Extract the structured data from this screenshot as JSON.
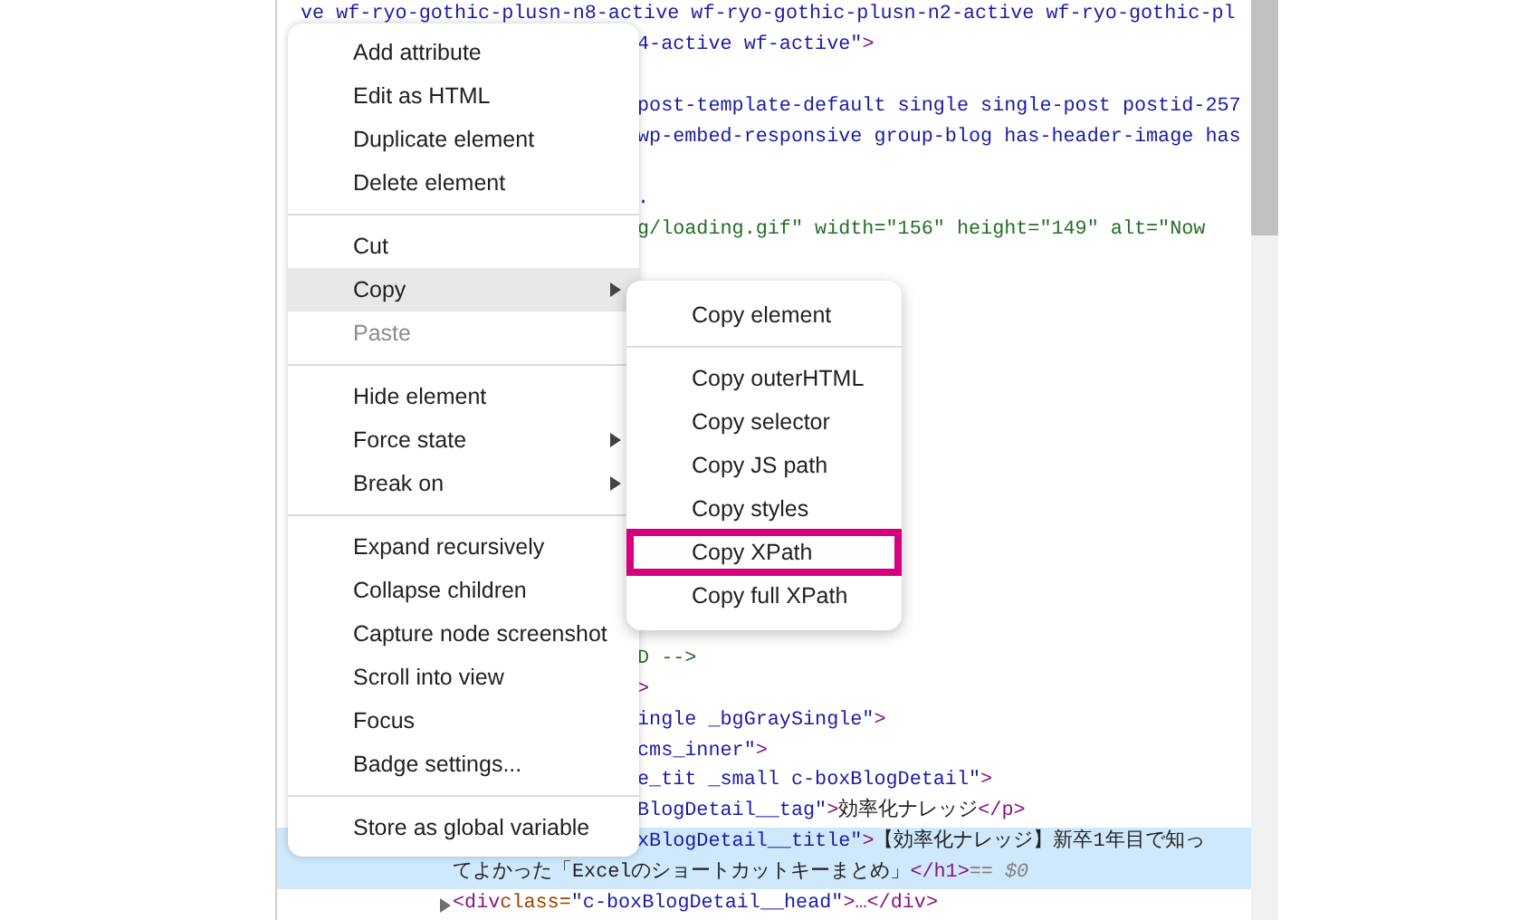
{
  "elements_panel": {
    "lines": [
      {
        "kind": "full",
        "selected": false,
        "segments": [
          {
            "kind": "value",
            "text": "ve wf-ryo-gothic-plusn-n8-active wf-ryo-gothic-plusn-n2-active wf-ryo-gothic-pl"
          }
        ]
      },
      {
        "kind": "clipped",
        "selected": false,
        "segments": [
          {
            "kind": "value",
            "text": "4-active wf-active\""
          },
          {
            "kind": "tag",
            "text": ">"
          }
        ]
      },
      {
        "kind": "covered",
        "selected": false
      },
      {
        "kind": "clipped",
        "selected": false,
        "segments": [
          {
            "kind": "value",
            "text": "post-template-default single single-post postid-257"
          }
        ]
      },
      {
        "kind": "clipped",
        "selected": false,
        "segments": [
          {
            "kind": "value",
            "text": "wp-embed-responsive group-blog has-header-image has"
          }
        ]
      },
      {
        "kind": "covered",
        "selected": false
      },
      {
        "kind": "clipped",
        "selected": false,
        "segments": [
          {
            "kind": "value",
            "text": "."
          }
        ]
      },
      {
        "kind": "clipped",
        "selected": false,
        "segments": [
          {
            "kind": "link",
            "text": "g/loading.gif\" width=\"156\" height=\"149\" alt=\"Now"
          }
        ]
      },
      {
        "kind": "covered",
        "selected": false
      },
      {
        "kind": "covered",
        "selected": false
      },
      {
        "kind": "covered",
        "selected": false
      },
      {
        "kind": "covered",
        "selected": false
      },
      {
        "kind": "covered",
        "selected": false
      },
      {
        "kind": "covered",
        "selected": false
      },
      {
        "kind": "covered",
        "selected": false
      },
      {
        "kind": "covered",
        "selected": false
      },
      {
        "kind": "covered",
        "selected": false
      },
      {
        "kind": "covered",
        "selected": false
      },
      {
        "kind": "covered",
        "selected": false
      },
      {
        "kind": "covered",
        "selected": false
      },
      {
        "kind": "covered",
        "selected": false
      },
      {
        "kind": "clipped",
        "selected": false,
        "segments": [
          {
            "kind": "comment",
            "text": "D -->"
          }
        ]
      },
      {
        "kind": "clipped",
        "selected": false,
        "segments": [
          {
            "kind": "tag",
            "text": ">"
          }
        ]
      },
      {
        "kind": "clipped",
        "selected": false,
        "segments": [
          {
            "kind": "value",
            "text": "ingle _bgGraySingle\""
          },
          {
            "kind": "tag",
            "text": ">"
          }
        ]
      },
      {
        "kind": "clipped",
        "selected": false,
        "segments": [
          {
            "kind": "value",
            "text": " cms_inner\""
          },
          {
            "kind": "tag",
            "text": ">"
          }
        ]
      },
      {
        "kind": "clipped",
        "selected": false,
        "segments": [
          {
            "kind": "value",
            "text": "e_tit _small c-boxBlogDetail\""
          },
          {
            "kind": "tag",
            "text": ">"
          }
        ]
      },
      {
        "kind": "clipped",
        "selected": false,
        "segments": [
          {
            "kind": "value",
            "text": "BlogDetail__tag\""
          },
          {
            "kind": "tag",
            "text": ">"
          },
          {
            "kind": "text",
            "text": "効率化ナレッジ"
          },
          {
            "kind": "tag",
            "text": "</p>"
          }
        ]
      },
      {
        "kind": "clipped",
        "selected": true,
        "segments": [
          {
            "kind": "value",
            "text": "xBlogDetail__title\""
          },
          {
            "kind": "tag",
            "text": ">"
          },
          {
            "kind": "text",
            "text": "【効率化ナレッジ】新卒1年目で知っ"
          }
        ]
      },
      {
        "kind": "wrap",
        "selected": true,
        "segments": [
          {
            "kind": "text",
            "text": "てよかった「Excelのショートカットキーまとめ」"
          },
          {
            "kind": "tag",
            "text": "</h1>"
          },
          {
            "kind": "hint",
            "text": " == $0"
          }
        ]
      },
      {
        "kind": "child",
        "selected": false,
        "segments": [
          {
            "kind": "tag",
            "text": "<div"
          },
          {
            "kind": "attr",
            "text": " class="
          },
          {
            "kind": "value",
            "text": "\"c-boxBlogDetail__head\""
          },
          {
            "kind": "tag",
            "text": ">…</div>"
          }
        ]
      }
    ]
  },
  "context_menu": {
    "groups": [
      {
        "items": [
          {
            "label": "Add attribute",
            "selected": false,
            "disabled": false,
            "has_submenu": false
          },
          {
            "label": "Edit as HTML",
            "selected": false,
            "disabled": false,
            "has_submenu": false
          },
          {
            "label": "Duplicate element",
            "selected": false,
            "disabled": false,
            "has_submenu": false
          },
          {
            "label": "Delete element",
            "selected": false,
            "disabled": false,
            "has_submenu": false
          }
        ]
      },
      {
        "items": [
          {
            "label": "Cut",
            "selected": false,
            "disabled": false,
            "has_submenu": false
          },
          {
            "label": "Copy",
            "selected": true,
            "disabled": false,
            "has_submenu": true
          },
          {
            "label": "Paste",
            "selected": false,
            "disabled": true,
            "has_submenu": false
          }
        ]
      },
      {
        "items": [
          {
            "label": "Hide element",
            "selected": false,
            "disabled": false,
            "has_submenu": false
          },
          {
            "label": "Force state",
            "selected": false,
            "disabled": false,
            "has_submenu": true
          },
          {
            "label": "Break on",
            "selected": false,
            "disabled": false,
            "has_submenu": true
          }
        ]
      },
      {
        "items": [
          {
            "label": "Expand recursively",
            "selected": false,
            "disabled": false,
            "has_submenu": false
          },
          {
            "label": "Collapse children",
            "selected": false,
            "disabled": false,
            "has_submenu": false
          },
          {
            "label": "Capture node screenshot",
            "selected": false,
            "disabled": false,
            "has_submenu": false
          },
          {
            "label": "Scroll into view",
            "selected": false,
            "disabled": false,
            "has_submenu": false
          },
          {
            "label": "Focus",
            "selected": false,
            "disabled": false,
            "has_submenu": false
          },
          {
            "label": "Badge settings...",
            "selected": false,
            "disabled": false,
            "has_submenu": false
          }
        ]
      },
      {
        "items": [
          {
            "label": "Store as global variable",
            "selected": false,
            "disabled": false,
            "has_submenu": false
          }
        ]
      }
    ]
  },
  "copy_submenu": {
    "groups": [
      {
        "items": [
          {
            "label": "Copy element",
            "highlighted": false
          }
        ]
      },
      {
        "items": [
          {
            "label": "Copy outerHTML",
            "highlighted": false
          },
          {
            "label": "Copy selector",
            "highlighted": false
          },
          {
            "label": "Copy JS path",
            "highlighted": false
          },
          {
            "label": "Copy styles",
            "highlighted": false
          },
          {
            "label": "Copy XPath",
            "highlighted": true
          },
          {
            "label": "Copy full XPath",
            "highlighted": false
          }
        ]
      }
    ]
  }
}
